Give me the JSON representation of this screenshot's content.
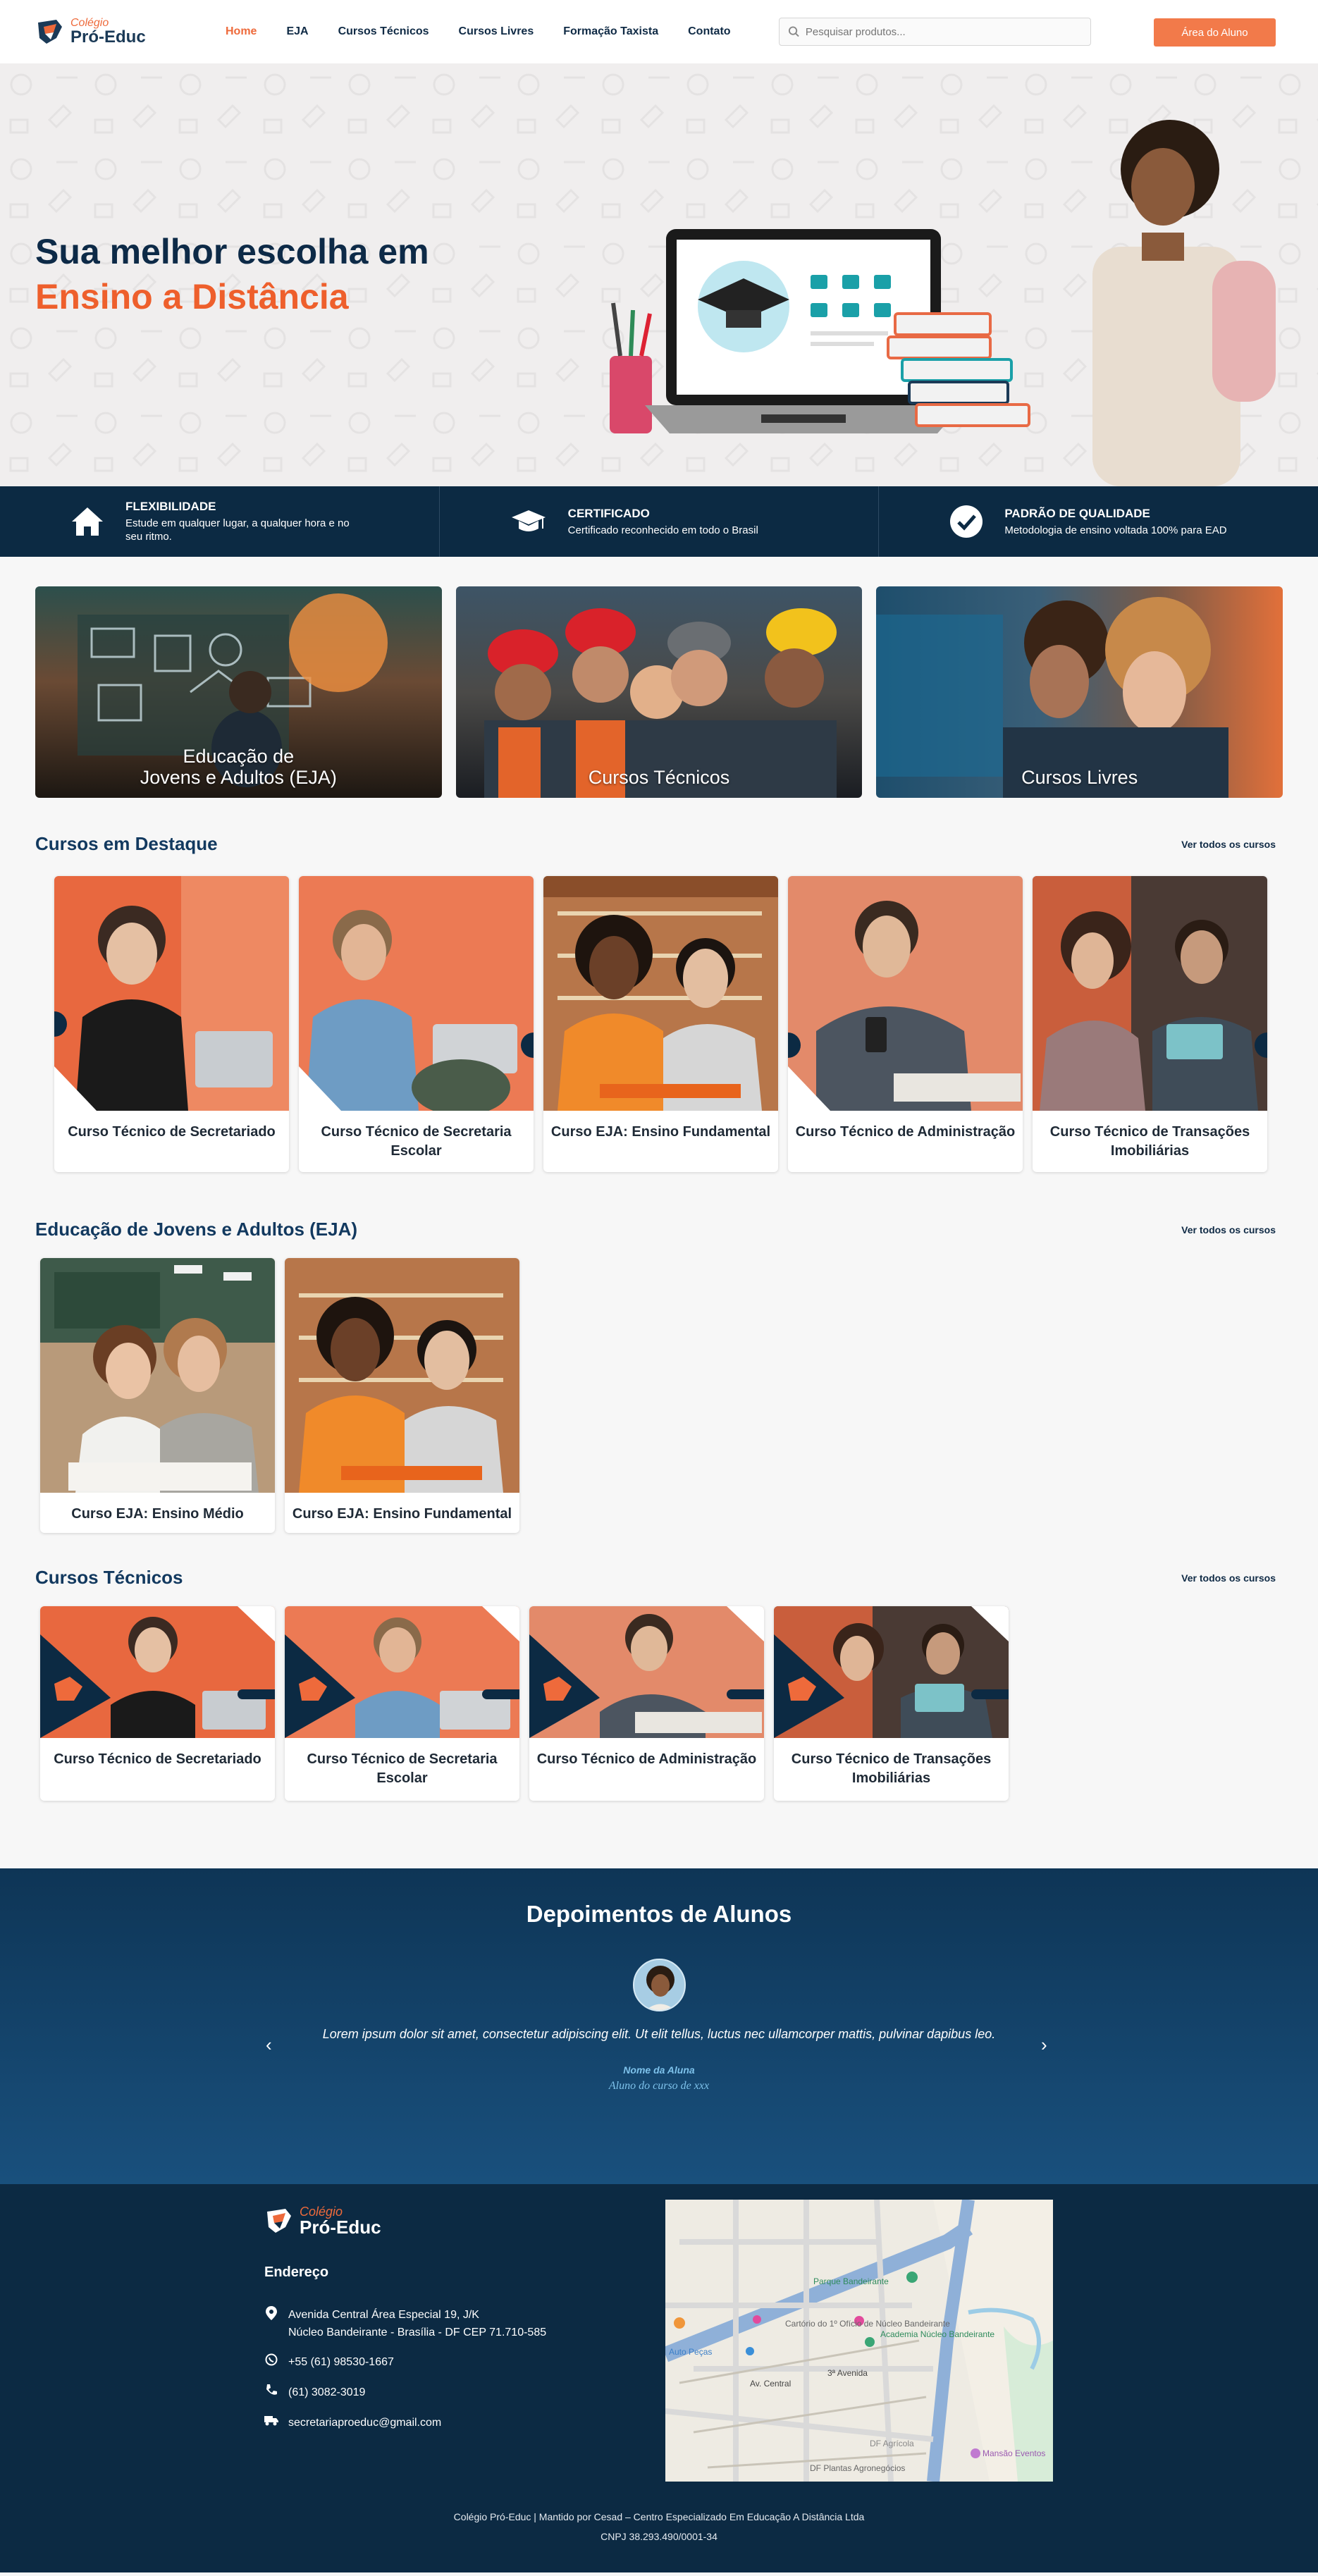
{
  "brand": {
    "small": "Colégio",
    "big": "Pró-Educ"
  },
  "nav": {
    "items": [
      "Home",
      "EJA",
      "Cursos Técnicos",
      "Cursos Livres",
      "Formação Taxista",
      "Contato"
    ],
    "search_placeholder": "Pesquisar produtos...",
    "aluno_button": "Área do Aluno"
  },
  "hero": {
    "line1": "Sua melhor escolha em",
    "line2": "Ensino a Distância"
  },
  "features": [
    {
      "icon": "home-icon",
      "title": "FLEXIBILIDADE",
      "desc": "Estude em qualquer lugar, a qualquer hora e no seu ritmo."
    },
    {
      "icon": "graduation-cap-icon",
      "title": "CERTIFICADO",
      "desc": "Certificado reconhecido em todo o Brasil"
    },
    {
      "icon": "check-circle-icon",
      "title": "PADRÃO DE QUALIDADE",
      "desc": "Metodologia de ensino voltada 100% para EAD"
    }
  ],
  "categories": [
    {
      "line1": "Educação de",
      "line2": "Jovens e Adultos (EJA)"
    },
    {
      "line1": "Cursos Técnicos",
      "line2": ""
    },
    {
      "line1": "Cursos Livres",
      "line2": ""
    }
  ],
  "destaque": {
    "title": "Cursos em Destaque",
    "link": "Ver todos os cursos",
    "courses": [
      "Curso Técnico de Secretariado",
      "Curso Técnico de Secretaria Escolar",
      "Curso EJA: Ensino Fundamental",
      "Curso Técnico de Administração",
      "Curso Técnico de Transações Imobiliárias"
    ]
  },
  "eja": {
    "title": "Educação de Jovens e Adultos (EJA)",
    "link": "Ver todos os cursos",
    "courses": [
      "Curso EJA: Ensino Médio",
      "Curso EJA: Ensino Fundamental"
    ]
  },
  "tecnicos": {
    "title": "Cursos Técnicos",
    "link": "Ver todos os cursos",
    "courses": [
      "Curso Técnico de Secretariado",
      "Curso Técnico de Secretaria Escolar",
      "Curso Técnico de Administração",
      "Curso Técnico de Transações Imobiliárias"
    ]
  },
  "testimonials": {
    "title": "Depoimentos de Alunos",
    "quote": "Lorem ipsum dolor sit amet, consectetur adipiscing elit. Ut elit tellus, luctus nec ullamcorper mattis, pulvinar dapibus leo.",
    "name": "Nome da Aluna",
    "role": "Aluno do curso de xxx"
  },
  "footer": {
    "address_title": "Endereço",
    "address_line1": "Avenida Central Área Especial 19, J/K",
    "address_line2": "Núcleo Bandeirante - Brasília - DF CEP 71.710-585",
    "whatsapp": "+55 (61) 98530-1667",
    "phone": "(61) 3082-3019",
    "email": "secretariaproeduc@gmail.com",
    "bottom1": "Colégio Pró-Educ | Mantido por Cesad – Centro Especializado Em Educação A Distância Ltda",
    "bottom2": "CNPJ 38.293.490/0001-34",
    "map_labels": [
      "Parque Bandeirante",
      "Cartório do 1º Ofício de Núcleo Bandeirante",
      "Academia Núcleo Bandeirante",
      "Auto Peças",
      "Av. Central",
      "3ª Avenida",
      "DF Plantas Agronegócios",
      "Mansão Eventos",
      "DF Agrícola"
    ]
  },
  "colors": {
    "navy": "#0c2a43",
    "orange": "#ee5f2c",
    "link": "#12395f"
  }
}
